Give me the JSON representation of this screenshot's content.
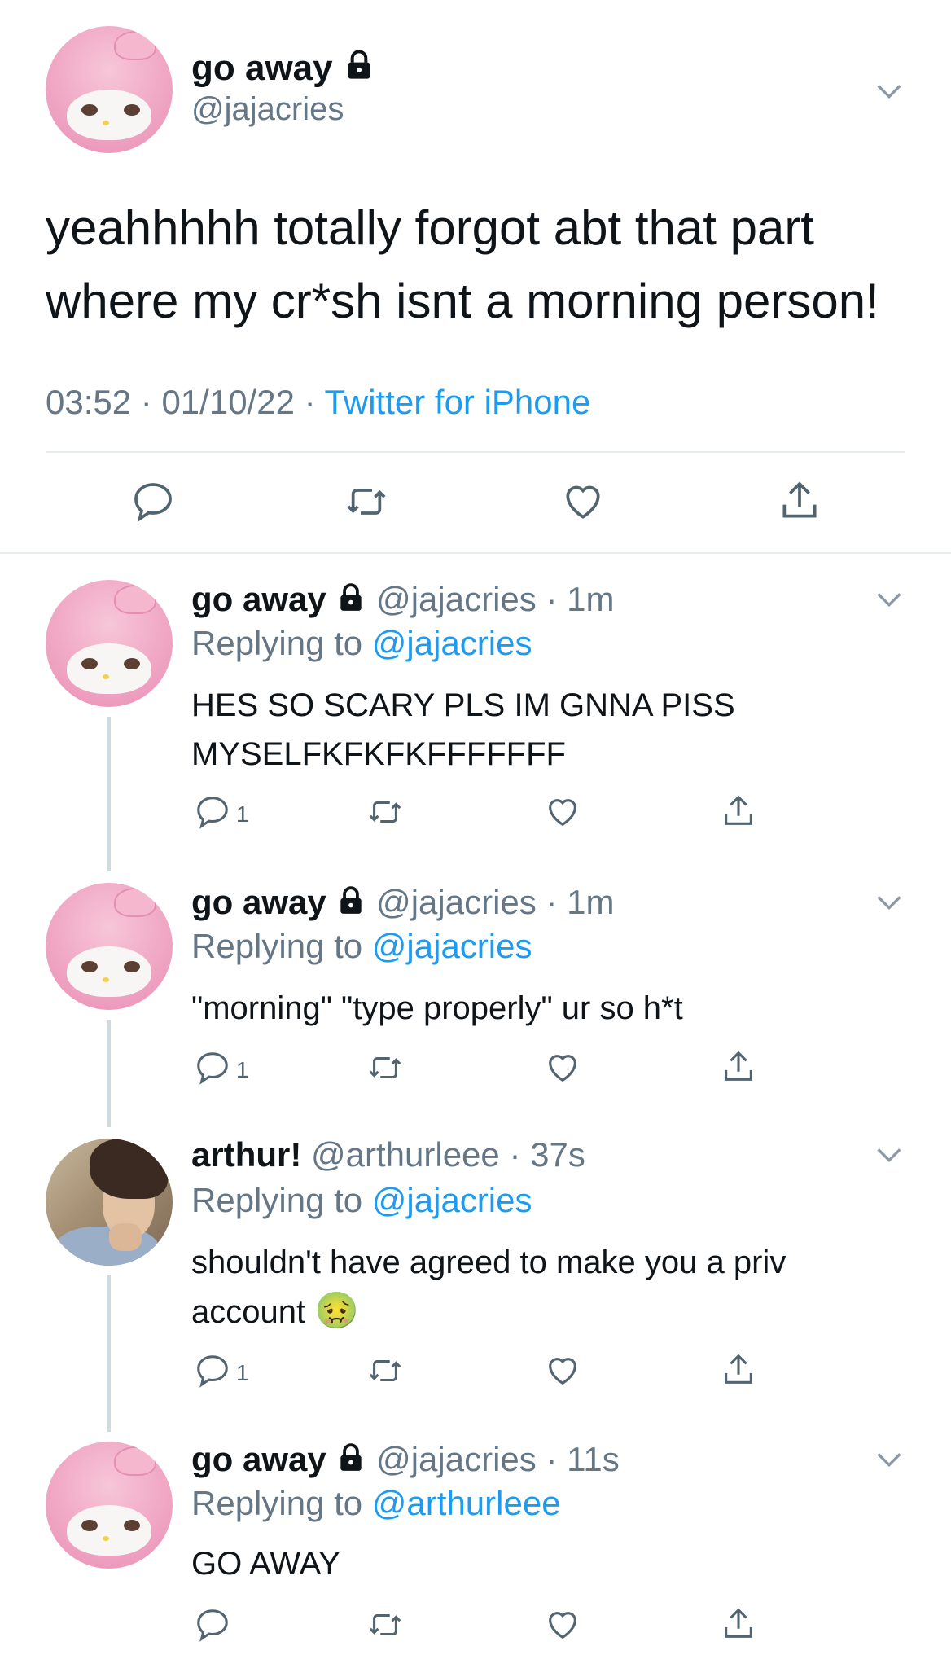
{
  "main_tweet": {
    "display_name": "go away",
    "handle": "@jajacries",
    "text_line1": "yeahhhhh totally forgot abt that part",
    "text_line2": "where my cr*sh isnt a morning person!",
    "time": "03:52",
    "sep1": "·",
    "date": "01/10/22",
    "sep2": "·",
    "source": "Twitter for iPhone"
  },
  "replies": [
    {
      "display_name": "go away",
      "handle": "@jajacries",
      "sep": "·",
      "age": "1m",
      "replying_prefix": "Replying to",
      "replying_to": "@jajacries",
      "line1": "HES SO SCARY PLS IM GNNA PISS",
      "line2": "MYSELFKFKFKFFFFFFF",
      "reply_count": "1"
    },
    {
      "display_name": "go away",
      "handle": "@jajacries",
      "sep": "·",
      "age": "1m",
      "replying_prefix": "Replying to",
      "replying_to": "@jajacries",
      "line1": "\"morning\" \"type properly\" ur so h*t",
      "reply_count": "1"
    },
    {
      "display_name": "arthur!",
      "handle": "@arthurleee",
      "sep": "·",
      "age": "37s",
      "replying_prefix": "Replying to",
      "replying_to": "@jajacries",
      "line1": "shouldn't have agreed to make you a priv",
      "line2": "account",
      "emoji": "🤢",
      "reply_count": "1"
    },
    {
      "display_name": "go away",
      "handle": "@jajacries",
      "sep": "·",
      "age": "11s",
      "replying_prefix": "Replying to",
      "replying_to": "@arthurleee",
      "line1": "GO AWAY"
    }
  ],
  "icons": {
    "lock": "lock-icon",
    "chevron": "chevron-down-icon",
    "reply": "reply-icon",
    "retweet": "retweet-icon",
    "like": "heart-icon",
    "share": "share-icon"
  },
  "colors": {
    "link": "#1d9bf0",
    "muted": "#657786",
    "divider": "#e6ecf0",
    "thread_line": "#cfd9de"
  }
}
